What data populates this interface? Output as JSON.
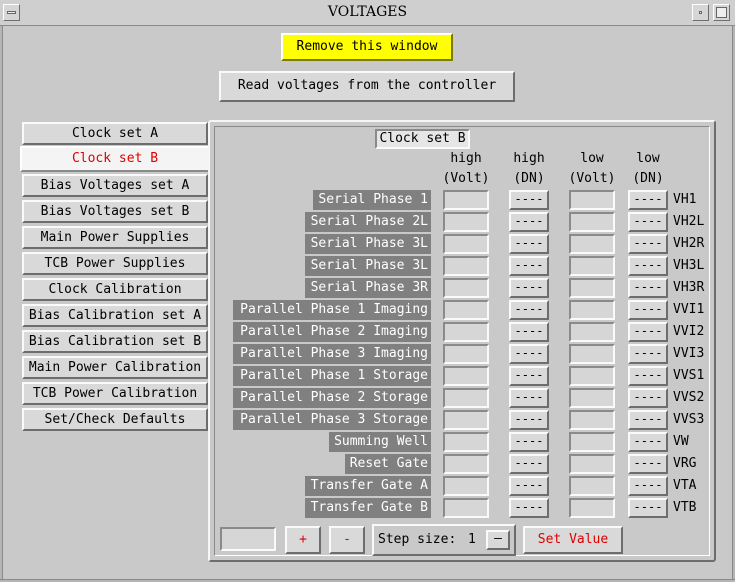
{
  "window": {
    "title": "VOLTAGES",
    "iconify_glyph": "—",
    "maximize_glyph": "□",
    "close_glyph": "⊠"
  },
  "top_buttons": {
    "remove": "Remove this window",
    "read": "Read voltages from the controller"
  },
  "sidebar": {
    "items": [
      {
        "label": "Clock set A",
        "active": false
      },
      {
        "label": "Clock set B",
        "active": true
      },
      {
        "label": "Bias Voltages set A",
        "active": false
      },
      {
        "label": "Bias Voltages set B",
        "active": false
      },
      {
        "label": "Main Power Supplies",
        "active": false
      },
      {
        "label": "TCB Power Supplies",
        "active": false
      },
      {
        "label": "Clock Calibration",
        "active": false
      },
      {
        "label": "Bias Calibration set A",
        "active": false
      },
      {
        "label": "Bias Calibration set B",
        "active": false
      },
      {
        "label": "Main Power Calibration",
        "active": false
      },
      {
        "label": "TCB Power Calibration",
        "active": false
      },
      {
        "label": "Set/Check Defaults",
        "active": false
      }
    ]
  },
  "panel": {
    "title": "Clock set B",
    "columns": [
      {
        "line1": "high",
        "line2": "(Volt)"
      },
      {
        "line1": "high",
        "line2": "(DN)"
      },
      {
        "line1": "low",
        "line2": "(Volt)"
      },
      {
        "line1": "low",
        "line2": "(DN)"
      }
    ],
    "dn_button_text": "----",
    "rows": [
      {
        "label": "Serial Phase 1",
        "code": "VH1"
      },
      {
        "label": "Serial Phase 2L",
        "code": "VH2L"
      },
      {
        "label": "Serial Phase 3L",
        "code": "VH2R"
      },
      {
        "label": "Serial Phase 3L",
        "code": "VH3L"
      },
      {
        "label": "Serial Phase 3R",
        "code": "VH3R"
      },
      {
        "label": "Parallel Phase 1 Imaging",
        "code": "VVI1"
      },
      {
        "label": "Parallel Phase 2 Imaging",
        "code": "VVI2"
      },
      {
        "label": "Parallel Phase 3 Imaging",
        "code": "VVI3"
      },
      {
        "label": "Parallel Phase 1 Storage",
        "code": "VVS1"
      },
      {
        "label": "Parallel Phase 2 Storage",
        "code": "VVS2"
      },
      {
        "label": "Parallel Phase 3 Storage",
        "code": "VVS3"
      },
      {
        "label": "Summing Well",
        "code": "VW"
      },
      {
        "label": "Reset Gate",
        "code": "VRG"
      },
      {
        "label": "Transfer Gate A",
        "code": "VTA"
      },
      {
        "label": "Transfer Gate B",
        "code": "VTB"
      }
    ]
  },
  "controls": {
    "value_input": "",
    "plus": "+",
    "minus": "-",
    "step_label": "Step size:",
    "step_value": "1",
    "step_menu_glyph": "—",
    "set_value": "Set Value"
  }
}
